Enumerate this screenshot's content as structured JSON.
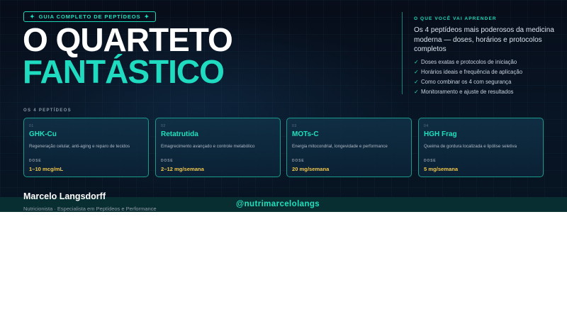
{
  "badge": {
    "text": "GUIA COMPLETO DE PEPTÍDEOS",
    "star": "✦"
  },
  "title": {
    "line1": "O QUARTETO",
    "line2": "FANTÁSTICO"
  },
  "learn": {
    "label": "O QUE VOCÊ VAI APRENDER",
    "intro": "Os 4 peptídeos mais poderosos da medicina moderna — doses, horários e protocolos completos",
    "check_icon": "✓",
    "items": [
      "Doses exatas e protocolos de iniciação",
      "Horários ideais e frequência de aplicação",
      "Como combinar os 4 com segurança",
      "Monitoramento e ajuste de resultados"
    ]
  },
  "section_label": "OS 4 PEPTÍDEOS",
  "cards": [
    {
      "num": "01",
      "name": "GHK-Cu",
      "desc": "Regeneração celular, anti-aging e reparo de tecidos",
      "dose_label": "DOSE",
      "dose": "1–10 mcg/mL"
    },
    {
      "num": "02",
      "name": "Retatrutida",
      "desc": "Emagrecimento avançado e controle metabólico",
      "dose_label": "DOSE",
      "dose": "2–12 mg/semana"
    },
    {
      "num": "03",
      "name": "MOTs-C",
      "desc": "Energia mitocondrial, longevidade e performance",
      "dose_label": "DOSE",
      "dose": "20 mg/semana"
    },
    {
      "num": "04",
      "name": "HGH Frag",
      "desc": "Queima de gordura localizada e lipólise seletiva",
      "dose_label": "DOSE",
      "dose": "5 mg/semana"
    }
  ],
  "author": {
    "name": "Marcelo Langsdorff",
    "role": "Nutricionista · Especialista em Peptídeos e Performance"
  },
  "handle": "@nutrimarcelolangs",
  "colors": {
    "accent": "#1fdcc0",
    "dose": "#f0c64a",
    "background": "#081525"
  }
}
